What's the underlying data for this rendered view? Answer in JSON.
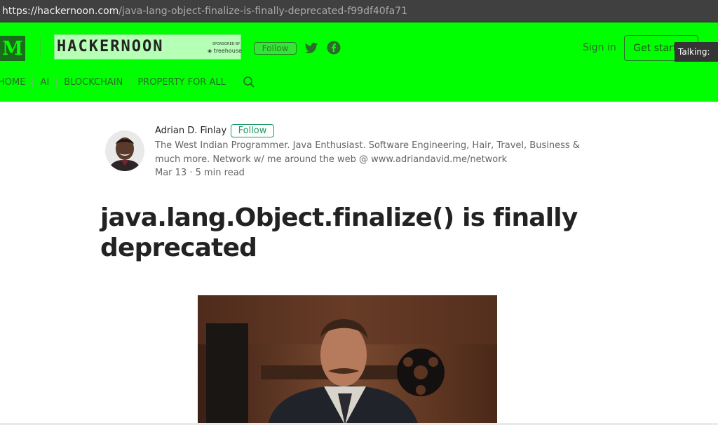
{
  "browser": {
    "url_host": "https://hackernoon.com",
    "url_path": "/java-lang-object-finalize-is-finally-deprecated-f99df40fa71"
  },
  "header": {
    "medium_logo": "M",
    "publication_logo": "HACKERNOON",
    "sponsored_by": "SPONSORED BY",
    "sponsor_name": "treehouse",
    "follow_label": "Follow",
    "sign_in_label": "Sign in",
    "get_started_label": "Get started",
    "nav": [
      "HOME",
      "AI",
      "BLOCKCHAIN",
      "PROPERTY FOR ALL"
    ],
    "icons": [
      "twitter-icon",
      "facebook-icon",
      "search-icon"
    ],
    "accent_color": "#00ff00"
  },
  "overlay": {
    "talking_label": "Talking:"
  },
  "author": {
    "name": "Adrian D. Finlay",
    "follow_label": "Follow",
    "bio": "The West Indian Programmer. Java Enthusiast. Software Engineering, Hair, Travel, Business & much more. Network w/ me around the web @ www.adriandavid.me/network",
    "meta": "Mar 13 · 5 min read"
  },
  "article": {
    "title": "java.lang.Object.finalize() is finally deprecated"
  }
}
